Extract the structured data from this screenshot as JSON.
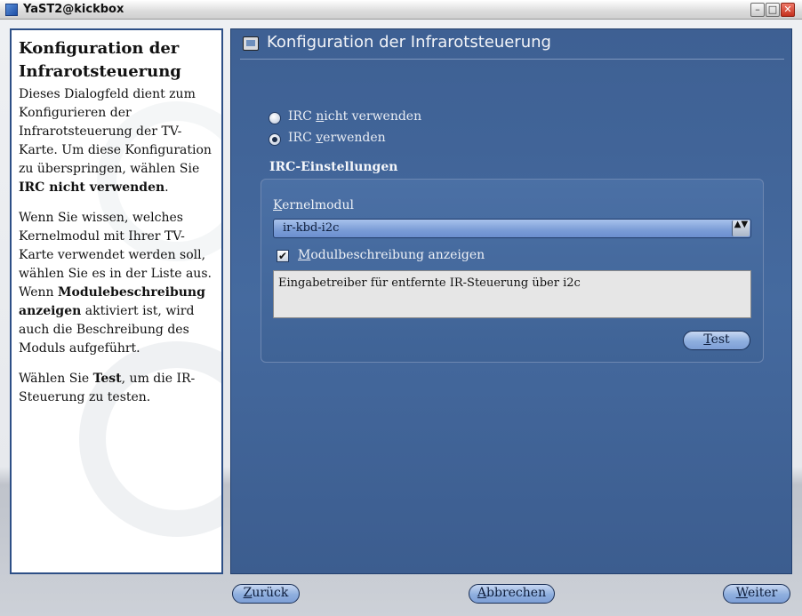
{
  "window": {
    "title": "YaST2@kickbox",
    "minimize_glyph": "–",
    "maximize_glyph": "□",
    "close_glyph": "✕"
  },
  "help": {
    "title": "Konfiguration der Infrarotsteuerung",
    "p1_a": "Dieses Dialogfeld dient zum Konfigurieren der Infrarotsteuerung der TV-Karte. Um diese Konfiguration zu überspringen, wählen Sie ",
    "p1_b": "IRC nicht verwenden",
    "p1_c": ".",
    "p2_a": "Wenn Sie wissen, welches Kernelmodul mit Ihrer TV-Karte verwendet werden soll, wählen Sie es in der Liste aus. Wenn ",
    "p2_b": "Modulebeschreibung anzeigen",
    "p2_c": " aktiviert ist, wird auch die Beschreibung des Moduls aufgeführt.",
    "p3_a": "Wählen Sie ",
    "p3_b": "Test",
    "p3_c": ", um die IR-Steuerung zu testen."
  },
  "main": {
    "title": "Konfiguration der Infrarotsteuerung",
    "radio_no": {
      "pre": "IRC ",
      "key": "n",
      "post": "icht verwenden",
      "checked": false
    },
    "radio_yes": {
      "pre": "IRC ",
      "key": "v",
      "post": "erwenden",
      "checked": true
    },
    "group_label": "IRC-Einstellungen",
    "kernel_label": {
      "key": "K",
      "rest": "ernelmodul"
    },
    "kernel_value": "ir-kbd-i2c",
    "show_desc": {
      "key": "M",
      "rest": "odulbeschreibung anzeigen",
      "checked": true,
      "mark": "✔"
    },
    "description": "Eingabetreiber für entfernte IR-Steuerung über i2c",
    "test_button": {
      "key": "T",
      "rest": "est"
    },
    "combo_arrows": "▲▼"
  },
  "footer": {
    "back": {
      "key": "Z",
      "rest": "urück"
    },
    "abort": {
      "key": "A",
      "rest": "bbrechen"
    },
    "next": {
      "key": "W",
      "rest": "eiter"
    }
  }
}
